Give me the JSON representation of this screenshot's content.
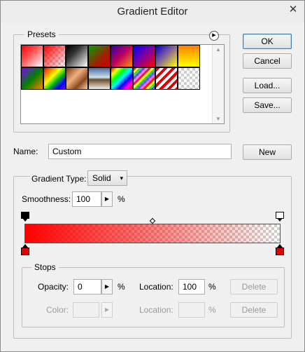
{
  "window": {
    "title": "Gradient Editor",
    "close_glyph": "✕"
  },
  "presets": {
    "label": "Presets",
    "menu_icon": "▶",
    "swatches": [
      "red-to-white",
      "red-to-transparent",
      "black-to-white",
      "green-to-red",
      "purple-to-orange",
      "blue-to-red",
      "blue-to-yellow",
      "orange-to-yellow",
      "violet-green-orange",
      "rainbow",
      "copper",
      "chrome",
      "spectrum",
      "transparent-stripes",
      "red-stripes",
      "transparent"
    ]
  },
  "buttons": {
    "ok": "OK",
    "cancel": "Cancel",
    "load": "Load...",
    "save": "Save...",
    "new": "New"
  },
  "name": {
    "label": "Name:",
    "value": "Custom"
  },
  "gradient": {
    "type_label": "Gradient Type:",
    "type_value": "Solid",
    "smoothness_label": "Smoothness:",
    "smoothness_value": "100",
    "smoothness_unit": "%",
    "color_start": "#ff0000",
    "opacity_start": 1.0,
    "opacity_end": 0.0
  },
  "stops": {
    "label": "Stops",
    "opacity_label": "Opacity:",
    "opacity_value": "0",
    "opacity_unit": "%",
    "location_label": "Location:",
    "location_value": "100",
    "location_unit": "%",
    "delete_label": "Delete",
    "color_label": "Color:",
    "color_location_label": "Location:",
    "color_location_unit": "%",
    "color_delete_label": "Delete"
  }
}
